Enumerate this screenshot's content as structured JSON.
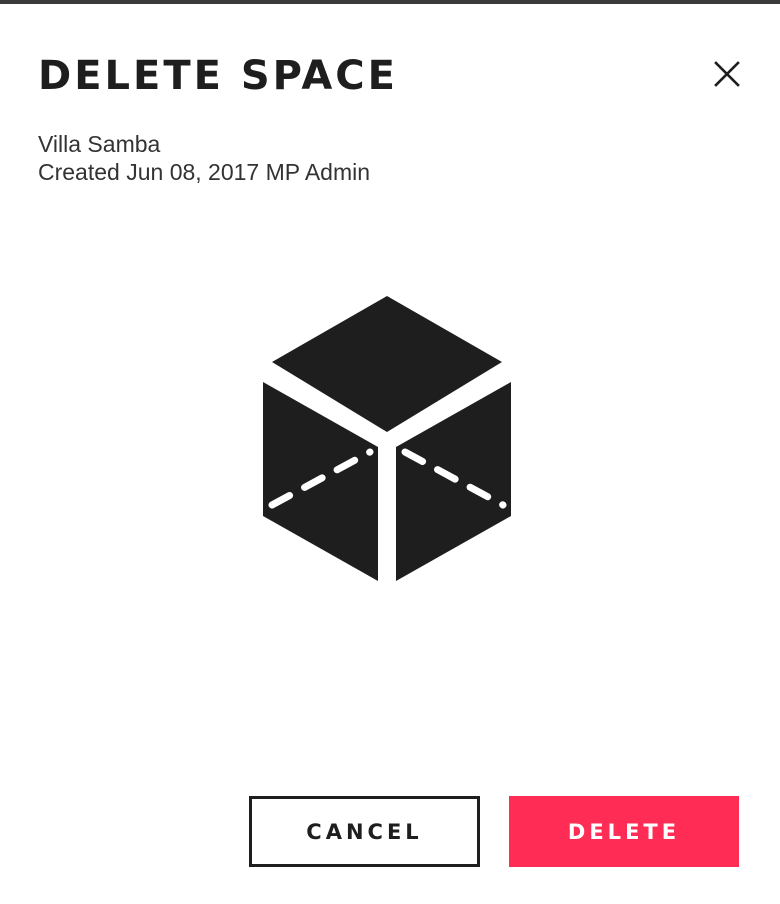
{
  "dialog": {
    "title": "DELETE SPACE",
    "close_icon": "close-icon",
    "space_name": "Villa Samba",
    "created_line": "Created Jun 08, 2017 MP Admin",
    "illustration_icon": "cube-icon",
    "cancel_label": "CANCEL",
    "delete_label": "DELETE"
  },
  "colors": {
    "text_dark": "#1e1e1e",
    "text_meta": "#333333",
    "danger": "#ff2d55",
    "background": "#ffffff",
    "top_border": "#3a3a3a"
  }
}
